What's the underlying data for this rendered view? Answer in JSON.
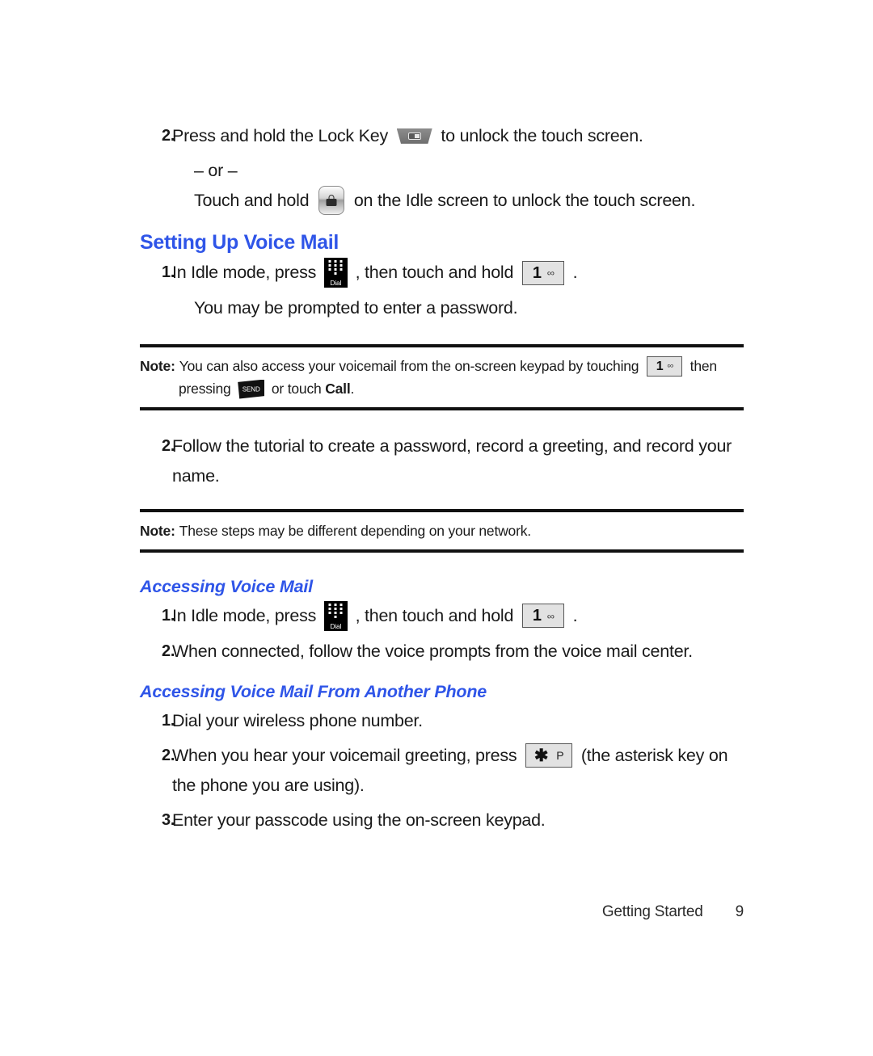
{
  "document": {
    "type": "user-manual-page",
    "heading_color": "#2f55e8",
    "text_color": "#1a1a1a"
  },
  "step_unlock": {
    "number": "2.",
    "text_before_icon": "Press and hold the Lock Key",
    "lock_key_icon": "lock-hardware-key-icon",
    "text_after_icon": "to unlock the touch screen.",
    "or_divider": "– or –",
    "alt_text_before_icon": "Touch and hold",
    "lock_button_icon": "lock-touch-button-icon",
    "alt_text_after_icon": "on the Idle screen to unlock the touch screen."
  },
  "setting_up": {
    "title": "Setting Up Voice Mail",
    "step1": {
      "number": "1.",
      "text_before_dial": "In Idle mode, press",
      "dial_icon": "dial-keypad-icon",
      "dial_icon_label": "Dial",
      "text_middle": ", then touch and hold",
      "voicemail_key_digit": "1",
      "voicemail_key_symbol": "∞",
      "text_after": ".",
      "subtext": "You may be prompted to enter a password."
    },
    "note1": {
      "label": "Note:",
      "text_before_key": "You can also access your voicemail from the on-screen keypad by touching",
      "voicemail_key_digit": "1",
      "voicemail_key_symbol": "∞",
      "text_after_key": "then",
      "line2_before_send": "pressing",
      "send_key_icon": "send-key-icon",
      "send_key_label": "SEND",
      "line2_after_send": "or touch",
      "line2_bold": "Call",
      "line2_end": "."
    },
    "step2": {
      "number": "2.",
      "text": "Follow the tutorial to create a password, record a greeting, and record your name."
    },
    "note2": {
      "label": "Note:",
      "text": "These steps may be different depending on your network."
    }
  },
  "accessing": {
    "title": "Accessing Voice Mail",
    "step1": {
      "number": "1.",
      "text_before_dial": "In Idle mode, press",
      "dial_icon": "dial-keypad-icon",
      "dial_icon_label": "Dial",
      "text_middle": ", then touch and hold",
      "voicemail_key_digit": "1",
      "voicemail_key_symbol": "∞",
      "text_after": "."
    },
    "step2": {
      "number": "2.",
      "text": "When connected, follow the voice prompts from the voice mail center."
    }
  },
  "another_phone": {
    "title": "Accessing Voice Mail From Another Phone",
    "step1": {
      "number": "1.",
      "text": "Dial your wireless phone number."
    },
    "step2": {
      "number": "2.",
      "text_before_key": "When you hear your voicemail greeting, press",
      "star_key_symbol": "✱",
      "star_key_label": "P",
      "text_after_key": "(the asterisk key on the phone you are using)."
    },
    "step3": {
      "number": "3.",
      "text": "Enter your passcode using the on-screen keypad."
    }
  },
  "footer": {
    "chapter": "Getting Started",
    "page_number": "9"
  }
}
